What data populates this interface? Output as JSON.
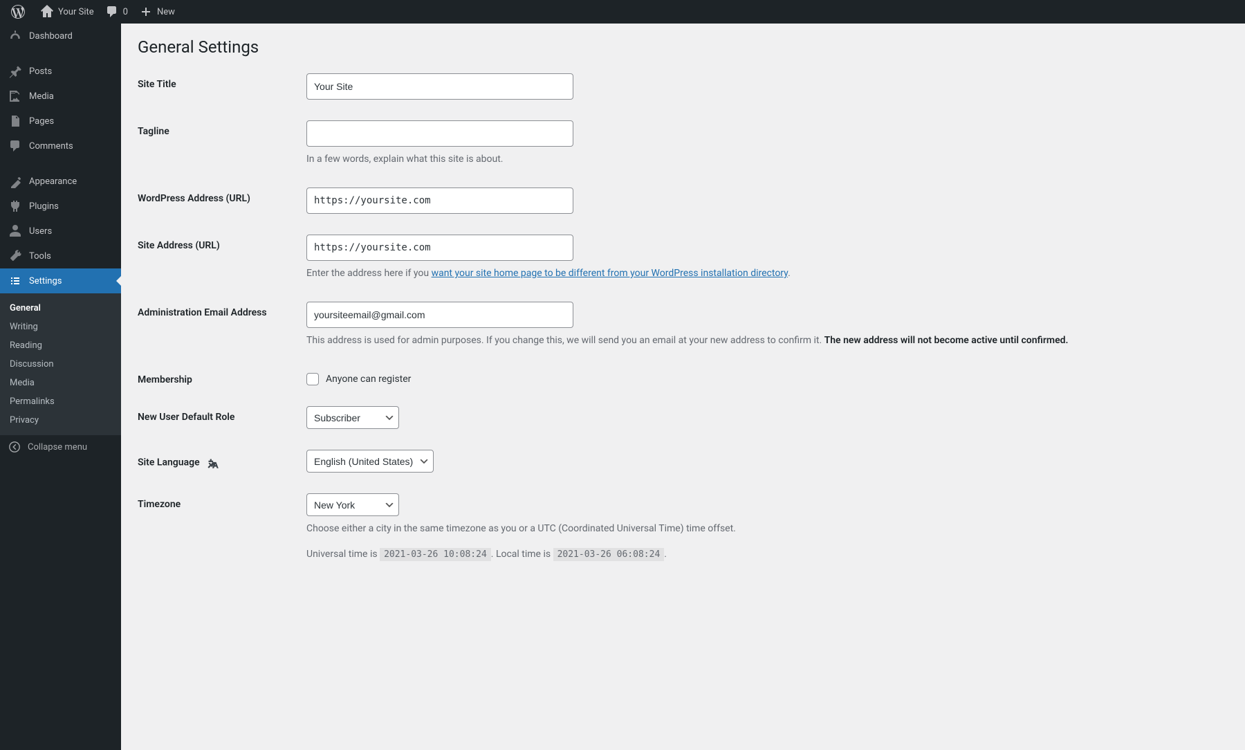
{
  "toolbar": {
    "site_name": "Your Site",
    "comments_count": "0",
    "new_label": "New"
  },
  "sidebar": {
    "items": [
      {
        "label": "Dashboard"
      },
      {
        "label": "Posts"
      },
      {
        "label": "Media"
      },
      {
        "label": "Pages"
      },
      {
        "label": "Comments"
      },
      {
        "label": "Appearance"
      },
      {
        "label": "Plugins"
      },
      {
        "label": "Users"
      },
      {
        "label": "Tools"
      },
      {
        "label": "Settings"
      }
    ],
    "submenu": [
      {
        "label": "General"
      },
      {
        "label": "Writing"
      },
      {
        "label": "Reading"
      },
      {
        "label": "Discussion"
      },
      {
        "label": "Media"
      },
      {
        "label": "Permalinks"
      },
      {
        "label": "Privacy"
      }
    ],
    "collapse_label": "Collapse menu"
  },
  "page": {
    "title": "General Settings",
    "site_title": {
      "label": "Site Title",
      "value": "Your Site"
    },
    "tagline": {
      "label": "Tagline",
      "value": "",
      "desc": "In a few words, explain what this site is about."
    },
    "wp_address": {
      "label": "WordPress Address (URL)",
      "value": "https://yoursite.com"
    },
    "site_address": {
      "label": "Site Address (URL)",
      "value": "https://yoursite.com",
      "desc_prefix": "Enter the address here if you ",
      "desc_link": "want your site home page to be different from your WordPress installation directory",
      "desc_suffix": "."
    },
    "admin_email": {
      "label": "Administration Email Address",
      "value": "yoursiteemail@gmail.com",
      "desc_prefix": "This address is used for admin purposes. If you change this, we will send you an email at your new address to confirm it. ",
      "desc_strong": "The new address will not become active until confirmed."
    },
    "membership": {
      "label": "Membership",
      "checkbox_label": "Anyone can register"
    },
    "default_role": {
      "label": "New User Default Role",
      "value": "Subscriber"
    },
    "site_language": {
      "label": "Site Language",
      "value": "English (United States)"
    },
    "timezone": {
      "label": "Timezone",
      "value": "New York",
      "desc1": "Choose either a city in the same timezone as you or a UTC (Coordinated Universal Time) time offset.",
      "desc2_prefix": "Universal time is ",
      "utc": "2021-03-26 10:08:24",
      "desc2_mid": ". Local time is ",
      "local": "2021-03-26 06:08:24",
      "desc2_suffix": "."
    }
  }
}
